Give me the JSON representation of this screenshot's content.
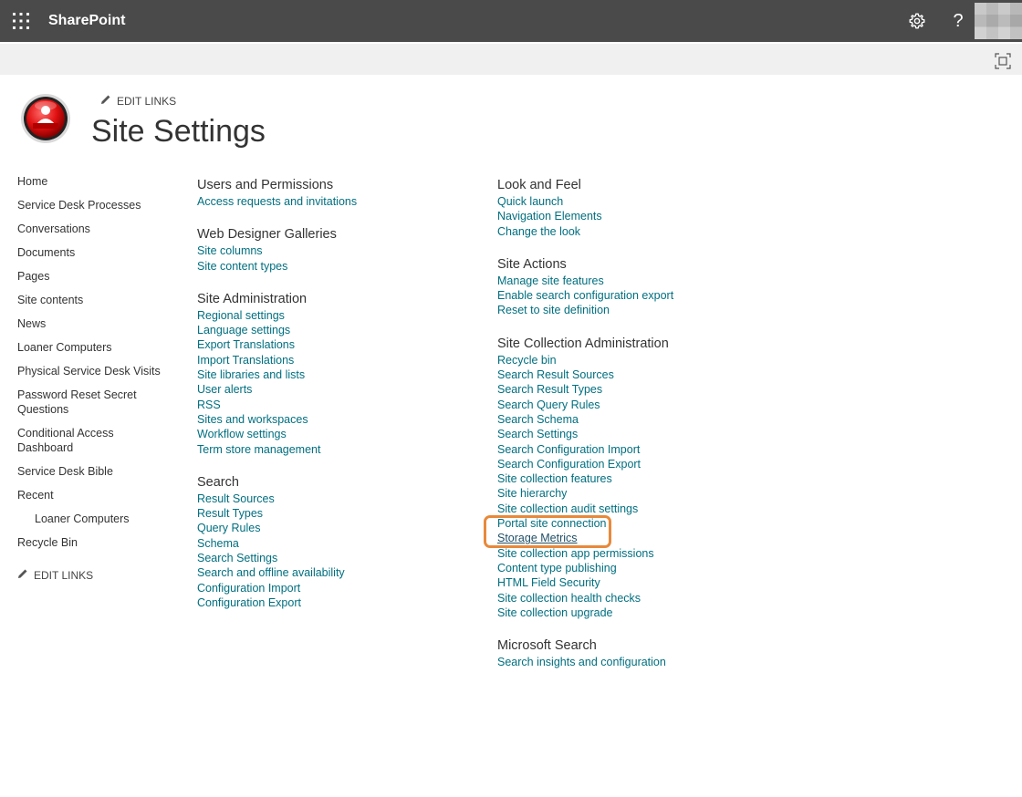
{
  "suite_bar": {
    "app_name": "SharePoint",
    "help_glyph": "?",
    "icons": [
      "waffle-icon",
      "gear-icon",
      "help-icon",
      "avatar"
    ]
  },
  "header": {
    "edit_links": "EDIT LINKS",
    "title": "Site Settings"
  },
  "left_nav": {
    "items": [
      {
        "label": "Home",
        "sub": false
      },
      {
        "label": "Service Desk Processes",
        "sub": false
      },
      {
        "label": "Conversations",
        "sub": false
      },
      {
        "label": "Documents",
        "sub": false
      },
      {
        "label": "Pages",
        "sub": false
      },
      {
        "label": "Site contents",
        "sub": false
      },
      {
        "label": "News",
        "sub": false
      },
      {
        "label": "Loaner Computers",
        "sub": false
      },
      {
        "label": "Physical Service Desk Visits",
        "sub": false
      },
      {
        "label": "Password Reset Secret Questions",
        "sub": false
      },
      {
        "label": "Conditional Access Dashboard",
        "sub": false
      },
      {
        "label": "Service Desk Bible",
        "sub": false
      },
      {
        "label": "Recent",
        "sub": false
      },
      {
        "label": "Loaner Computers",
        "sub": true
      },
      {
        "label": "Recycle Bin",
        "sub": false
      }
    ],
    "edit_links": "EDIT LINKS"
  },
  "columns": {
    "col1": [
      {
        "title": "Users and Permissions",
        "links": [
          "Access requests and invitations"
        ]
      },
      {
        "title": "Web Designer Galleries",
        "links": [
          "Site columns",
          "Site content types"
        ]
      },
      {
        "title": "Site Administration",
        "links": [
          "Regional settings",
          "Language settings",
          "Export Translations",
          "Import Translations",
          "Site libraries and lists",
          "User alerts",
          "RSS",
          "Sites and workspaces",
          "Workflow settings",
          "Term store management"
        ]
      },
      {
        "title": "Search",
        "links": [
          "Result Sources",
          "Result Types",
          "Query Rules",
          "Schema",
          "Search Settings",
          "Search and offline availability",
          "Configuration Import",
          "Configuration Export"
        ]
      }
    ],
    "col2": [
      {
        "title": "Look and Feel",
        "links": [
          "Quick launch",
          "Navigation Elements",
          "Change the look"
        ]
      },
      {
        "title": "Site Actions",
        "links": [
          "Manage site features",
          "Enable search configuration export",
          "Reset to site definition"
        ]
      },
      {
        "title": "Site Collection Administration",
        "links_before": [
          "Recycle bin",
          "Search Result Sources",
          "Search Result Types",
          "Search Query Rules",
          "Search Schema",
          "Search Settings",
          "Search Configuration Import",
          "Search Configuration Export",
          "Site collection features",
          "Site hierarchy",
          "Site collection audit settings",
          "Portal site connection"
        ],
        "highlighted_link": "Storage Metrics",
        "links_after": [
          "Site collection app permissions",
          "Content type publishing",
          "HTML Field Security",
          "Site collection health checks",
          "Site collection upgrade"
        ]
      },
      {
        "title": "Microsoft Search",
        "links": [
          "Search insights and configuration"
        ]
      }
    ]
  },
  "colors": {
    "suite_bar": "#4a4a4a",
    "link": "#006f80",
    "highlight": "#e8893a"
  }
}
